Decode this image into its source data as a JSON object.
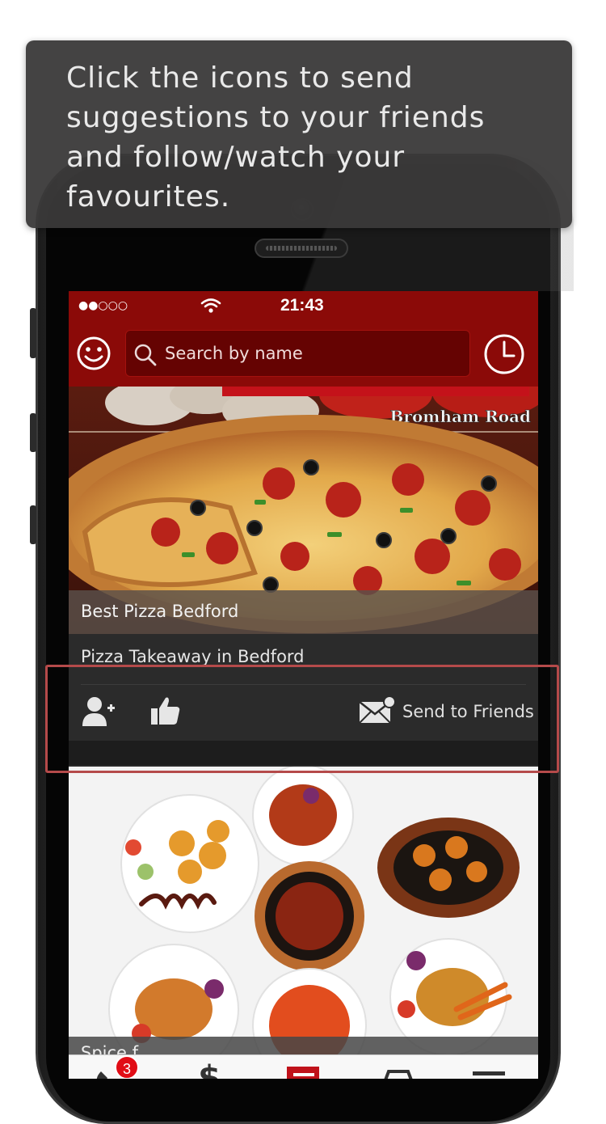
{
  "tooltip": {
    "text": "Click the icons to send suggestions to your friends and follow/watch your favourites."
  },
  "statusbar": {
    "signal": "●●○○○",
    "time": "21:43"
  },
  "navbar": {
    "search_placeholder": "Search by name"
  },
  "card1": {
    "image_caption": "Bromham Road",
    "title": "Best Pizza Bedford",
    "subtitle": "Pizza Takeaway in Bedford",
    "send_label": "Send to Friends"
  },
  "card2": {
    "title": "Spice f..."
  },
  "tabbar": {
    "badge_count": "3",
    "dollar_icon": "$"
  },
  "colors": {
    "brand_red": "#8b0a08",
    "highlight_border": "#b54a4a",
    "tooltip_bg": "#3a3939"
  },
  "icons": [
    "smiley-icon",
    "search-icon",
    "clock-icon",
    "add-friend-icon",
    "thumbs-up-icon",
    "envelope-icon",
    "phone-tab-icon",
    "dollar-tab-icon",
    "menu-tab-icon",
    "car-tab-icon",
    "hamburger-tab-icon"
  ]
}
